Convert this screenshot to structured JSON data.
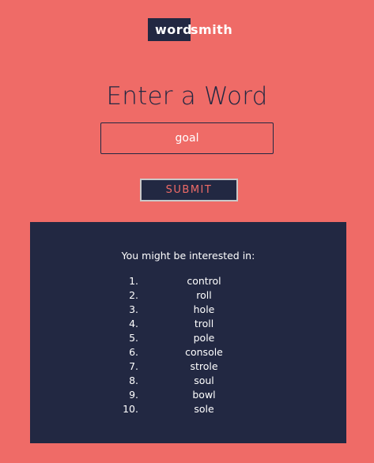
{
  "logo": {
    "part1": "word",
    "part2": "smith"
  },
  "heading": "Enter a Word",
  "search": {
    "value": "goal"
  },
  "submit_label": "SUBMIT",
  "results": {
    "heading": "You might be interested in:",
    "items": [
      {
        "num": "1.",
        "word": "control"
      },
      {
        "num": "2.",
        "word": "roll"
      },
      {
        "num": "3.",
        "word": "hole"
      },
      {
        "num": "4.",
        "word": "troll"
      },
      {
        "num": "5.",
        "word": "pole"
      },
      {
        "num": "6.",
        "word": "console"
      },
      {
        "num": "7.",
        "word": "strole"
      },
      {
        "num": "8.",
        "word": "soul"
      },
      {
        "num": "9.",
        "word": "bowl"
      },
      {
        "num": "10.",
        "word": "sole"
      }
    ]
  },
  "colors": {
    "background": "#ef6b67",
    "navy": "#222842",
    "button_border": "#c9c9c9"
  }
}
